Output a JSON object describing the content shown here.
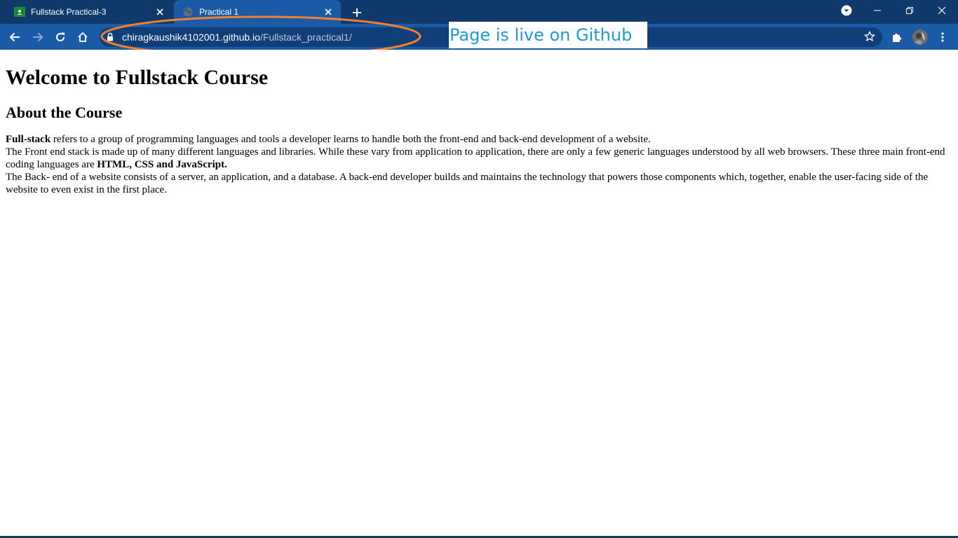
{
  "browser": {
    "tabs": [
      {
        "title": "Fullstack Practical-3",
        "favicon": "google-classroom-icon",
        "active": false
      },
      {
        "title": "Practical 1",
        "favicon": "globe-icon",
        "active": true
      }
    ],
    "url_host": "chiragkaushik4102001.github.io",
    "url_path": "/Fullstack_practical1/",
    "colors": {
      "tabstrip": "#0f3a6b",
      "toolbar": "#1b5aa6",
      "omnibox": "#0f3e78"
    }
  },
  "annotation": {
    "text": "Page is live on Github",
    "ellipse_color": "#f08030",
    "text_color": "#1e9ad6"
  },
  "page": {
    "heading": "Welcome to Fullstack Course",
    "subheading": "About the Course",
    "line1_bold": "Full-stack",
    "line1_rest": " refers to a group of programming languages and tools a developer learns to handle both the front-end and back-end development of a website.",
    "line2_text": "The Front end stack is made up of many different languages and libraries. While these vary from application to application, there are only a few generic languages understood by all web browsers. These three main front-end coding languages are ",
    "line2_bold": "HTML, CSS and JavaScript.",
    "line3_text": "The Back- end of a website consists of a server, an application, and a database. A back-end developer builds and maintains the technology that powers those components which, together, enable the user-facing side of the website to even exist in the first place."
  }
}
